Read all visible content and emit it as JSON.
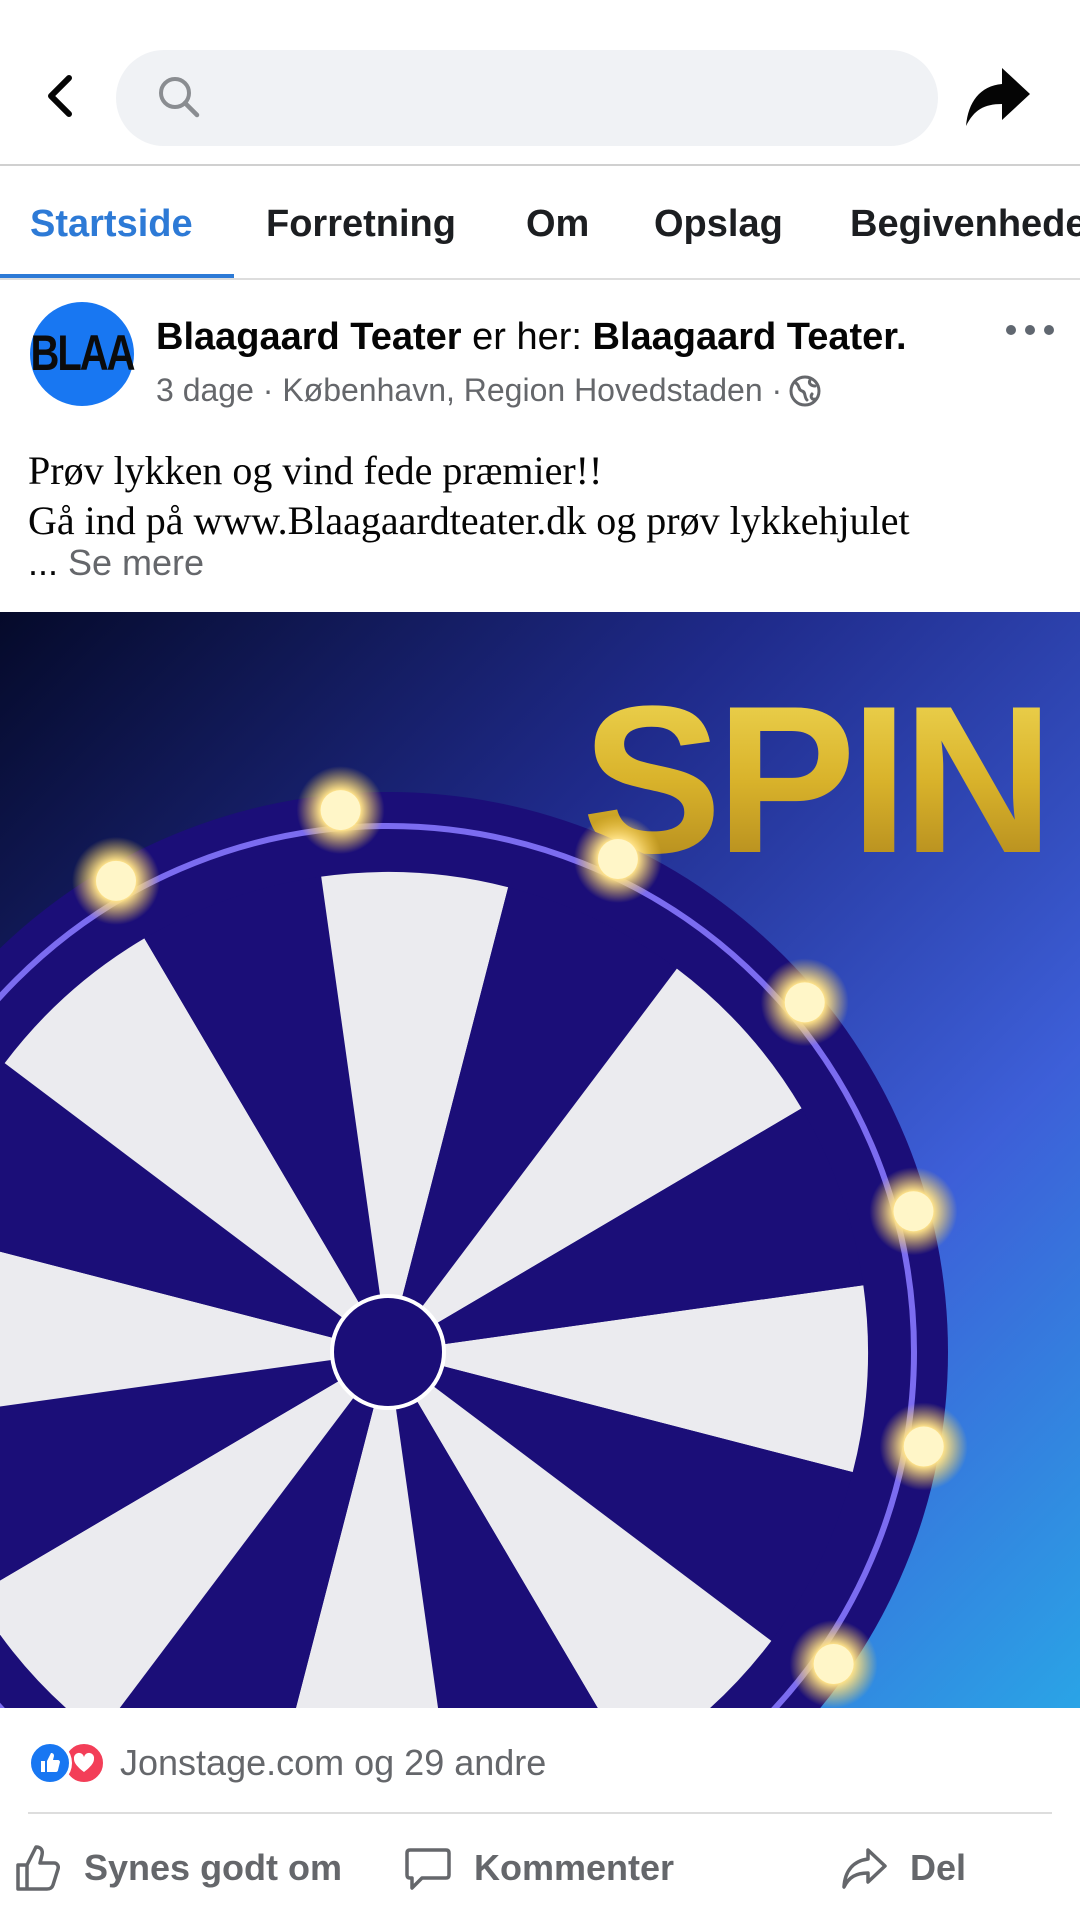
{
  "header": {
    "back_icon": "chevron-left-icon",
    "search_icon": "search-icon",
    "search_placeholder": "",
    "share_icon": "share-arrow-icon"
  },
  "tabs": [
    {
      "label": "Startside",
      "active": true
    },
    {
      "label": "Forretning",
      "active": false
    },
    {
      "label": "Om",
      "active": false
    },
    {
      "label": "Opslag",
      "active": false
    },
    {
      "label": "Begivenhede",
      "active": false
    }
  ],
  "post": {
    "avatar_text": "BLAA",
    "author": "Blaagaard Teater",
    "connector": " er her: ",
    "location_tag": "Blaagaard Teater.",
    "meta": "3 dage · København, Region Hovedstaden ·",
    "text_line1": "Prøv lykken og vind fede præmier!!",
    "text_line2": "Gå ind på www.Blaagaardteater.dk og prøv lykkehjulet",
    "ellipsis": "... ",
    "see_more": "Se mere",
    "image_text": "SPIN"
  },
  "reactions": {
    "text": "Jonstage.com og 29 andre"
  },
  "actions": {
    "like": "Synes godt om",
    "comment": "Kommenter",
    "share": "Del"
  },
  "colors": {
    "accent": "#2d7ad6",
    "wheel_dark": "#1b0e78",
    "wheel_light": "#ebebef",
    "spin_gold": "#e4c12f",
    "bg_blue": "#3b5ed6"
  }
}
